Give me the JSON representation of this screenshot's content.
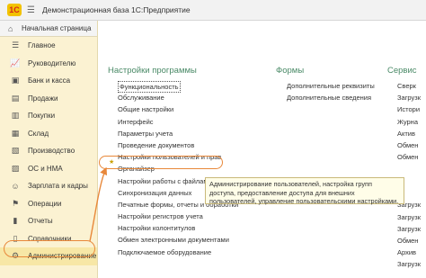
{
  "window": {
    "logo_text": "1С",
    "title": "Демонстрационная база 1С:Предприятие"
  },
  "sidebar": {
    "home_label": "Начальная страница",
    "items": [
      {
        "label": "Главное",
        "icon": "list-icon"
      },
      {
        "label": "Руководителю",
        "icon": "chart-icon"
      },
      {
        "label": "Банк и касса",
        "icon": "bank-icon"
      },
      {
        "label": "Продажи",
        "icon": "cart-icon"
      },
      {
        "label": "Покупки",
        "icon": "basket-icon"
      },
      {
        "label": "Склад",
        "icon": "warehouse-icon"
      },
      {
        "label": "Производство",
        "icon": "factory-icon"
      },
      {
        "label": "ОС и НМА",
        "icon": "assets-icon"
      },
      {
        "label": "Зарплата и кадры",
        "icon": "people-icon"
      },
      {
        "label": "Операции",
        "icon": "operations-icon"
      },
      {
        "label": "Отчеты",
        "icon": "reports-icon"
      },
      {
        "label": "Справочники",
        "icon": "books-icon"
      },
      {
        "label": "Администрирование",
        "icon": "gear-icon"
      }
    ]
  },
  "main": {
    "columns": [
      {
        "header": "Настройки программы",
        "links": [
          "Функциональность",
          "Обслуживание",
          "Общие настройки",
          "Интерфейс",
          "Параметры учета",
          "Проведение документов",
          "Настройки пользователей и прав",
          "Органайзер",
          "Настройки работы с файлами",
          "Синхронизация данных",
          "Печатные формы, отчеты и обработки",
          "Настройки регистров учета",
          "Настройки колонтитулов",
          "Обмен электронными документами",
          "Подключаемое оборудование"
        ]
      },
      {
        "header": "Формы",
        "links": [
          "Дополнительные реквизиты",
          "Дополнительные сведения"
        ]
      },
      {
        "header": "Сервис",
        "links": [
          "Сверк",
          "Загрузк",
          "Истори",
          "Журна",
          "Актив",
          "Обмен",
          "Обмен"
        ]
      }
    ],
    "right_lower_links": [
      "Обмен",
      "Загрузк",
      "Загрузк",
      "Загрузк",
      "Обмен",
      "Архив",
      "Загрузк"
    ],
    "tooltip": "Администрирование пользователей, настройка групп доступа, предоставление доступа для внешних пользователей, управление пользовательскими настройками."
  },
  "colors": {
    "sidebar_bg": "#fbf2d2",
    "section_header": "#4a8a67",
    "highlight": "#e8883a"
  }
}
